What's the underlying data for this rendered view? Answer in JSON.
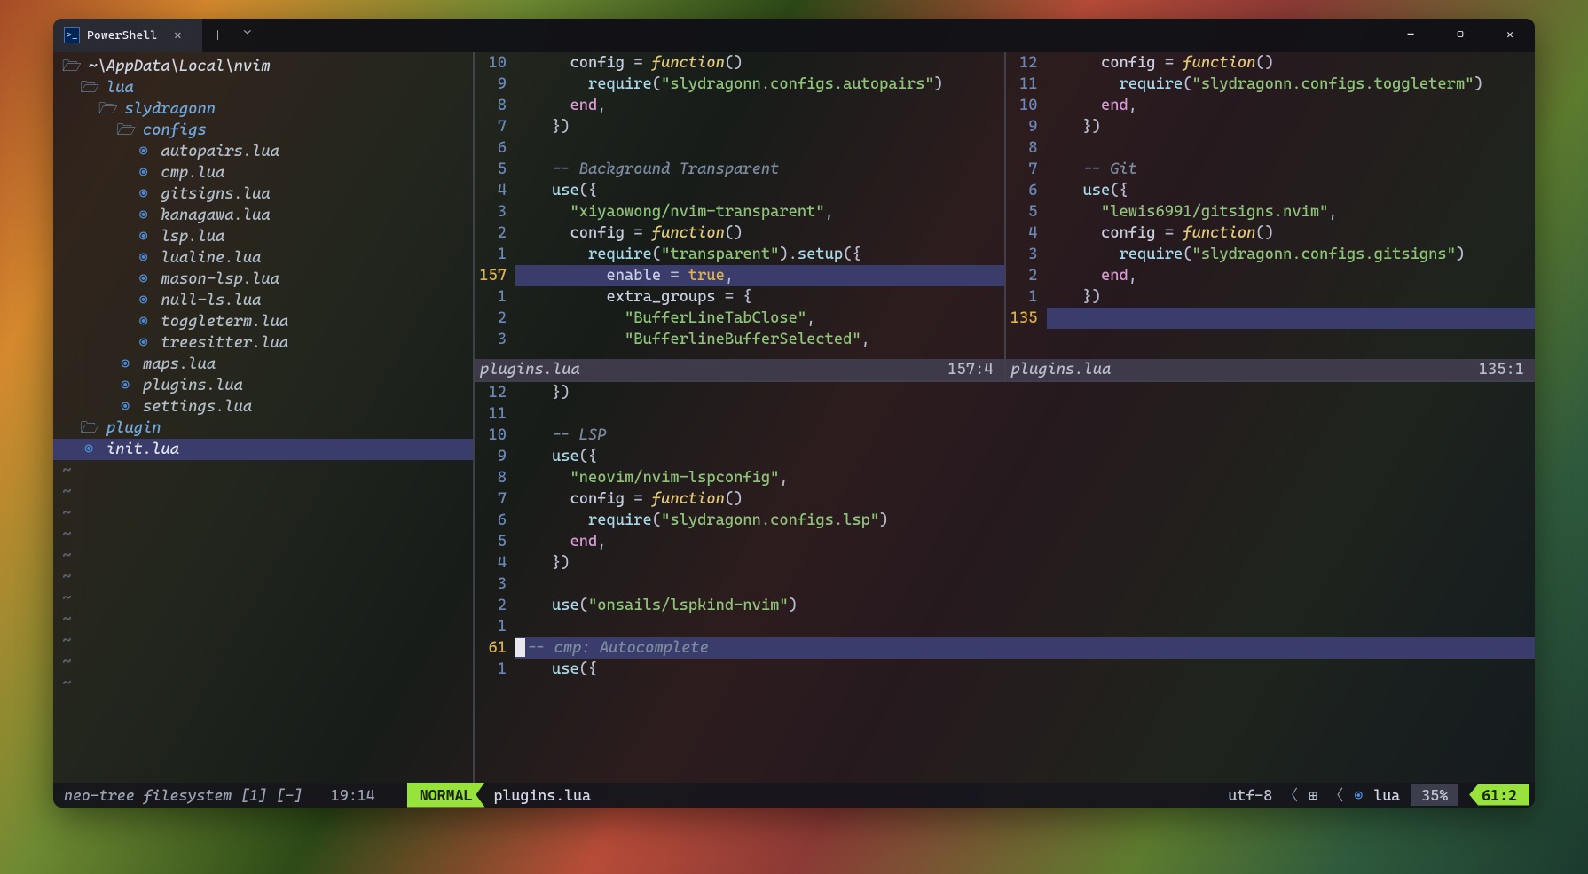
{
  "titlebar": {
    "tab_label": "PowerShell"
  },
  "tree": {
    "root": "~\\AppData\\Local\\nvim",
    "items": [
      {
        "depth": 1,
        "kind": "dir",
        "name": "lua"
      },
      {
        "depth": 2,
        "kind": "dir",
        "name": "slydragonn"
      },
      {
        "depth": 3,
        "kind": "dir",
        "name": "configs"
      },
      {
        "depth": 4,
        "kind": "file",
        "name": "autopairs.lua"
      },
      {
        "depth": 4,
        "kind": "file",
        "name": "cmp.lua"
      },
      {
        "depth": 4,
        "kind": "file",
        "name": "gitsigns.lua"
      },
      {
        "depth": 4,
        "kind": "file",
        "name": "kanagawa.lua"
      },
      {
        "depth": 4,
        "kind": "file",
        "name": "lsp.lua"
      },
      {
        "depth": 4,
        "kind": "file",
        "name": "lualine.lua"
      },
      {
        "depth": 4,
        "kind": "file",
        "name": "mason-lsp.lua"
      },
      {
        "depth": 4,
        "kind": "file",
        "name": "null-ls.lua"
      },
      {
        "depth": 4,
        "kind": "file",
        "name": "toggleterm.lua"
      },
      {
        "depth": 4,
        "kind": "file",
        "name": "treesitter.lua"
      },
      {
        "depth": 3,
        "kind": "file",
        "name": "maps.lua"
      },
      {
        "depth": 3,
        "kind": "file",
        "name": "plugins.lua"
      },
      {
        "depth": 3,
        "kind": "file",
        "name": "settings.lua"
      },
      {
        "depth": 1,
        "kind": "dir",
        "name": "plugin"
      },
      {
        "depth": 1,
        "kind": "file",
        "name": "init.lua",
        "active": true
      }
    ]
  },
  "pane_left": {
    "status_name": "plugins.lua",
    "status_pos": "157:4",
    "lines": [
      {
        "n": "10",
        "seg": [
          [
            "sp",
            "      "
          ],
          [
            "id",
            "config"
          ],
          [
            "op",
            " = "
          ],
          [
            "fn",
            "function"
          ],
          [
            "op",
            "()"
          ]
        ]
      },
      {
        "n": "9",
        "seg": [
          [
            "sp",
            "        "
          ],
          [
            "call",
            "require"
          ],
          [
            "op",
            "("
          ],
          [
            "str",
            "\"slydragonn.configs.autopairs\""
          ],
          [
            "op",
            ")"
          ]
        ]
      },
      {
        "n": "8",
        "seg": [
          [
            "sp",
            "      "
          ],
          [
            "kw",
            "end"
          ],
          [
            "op",
            ","
          ]
        ]
      },
      {
        "n": "7",
        "seg": [
          [
            "sp",
            "    "
          ],
          [
            "op",
            "})"
          ]
        ]
      },
      {
        "n": "6",
        "seg": []
      },
      {
        "n": "5",
        "seg": [
          [
            "sp",
            "    "
          ],
          [
            "com",
            "-- Background Transparent"
          ]
        ]
      },
      {
        "n": "4",
        "seg": [
          [
            "sp",
            "    "
          ],
          [
            "call",
            "use"
          ],
          [
            "op",
            "({"
          ]
        ]
      },
      {
        "n": "3",
        "seg": [
          [
            "sp",
            "      "
          ],
          [
            "str",
            "\"xiyaowong/nvim-transparent\""
          ],
          [
            "op",
            ","
          ]
        ]
      },
      {
        "n": "2",
        "seg": [
          [
            "sp",
            "      "
          ],
          [
            "id",
            "config"
          ],
          [
            "op",
            " = "
          ],
          [
            "fn",
            "function"
          ],
          [
            "op",
            "()"
          ]
        ]
      },
      {
        "n": "1",
        "seg": [
          [
            "sp",
            "        "
          ],
          [
            "call",
            "require"
          ],
          [
            "op",
            "("
          ],
          [
            "str",
            "\"transparent\""
          ],
          [
            "op",
            ")."
          ],
          [
            "call",
            "setup"
          ],
          [
            "op",
            "({"
          ]
        ]
      },
      {
        "n": "157",
        "cur": true,
        "seg": [
          [
            "sp",
            "          "
          ],
          [
            "id",
            "enable"
          ],
          [
            "op",
            " = "
          ],
          [
            "bool",
            "true"
          ],
          [
            "op",
            ","
          ]
        ]
      },
      {
        "n": "1",
        "seg": [
          [
            "sp",
            "          "
          ],
          [
            "id",
            "extra_groups"
          ],
          [
            "op",
            " = {"
          ]
        ]
      },
      {
        "n": "2",
        "seg": [
          [
            "sp",
            "            "
          ],
          [
            "str",
            "\"BufferLineTabClose\""
          ],
          [
            "op",
            ","
          ]
        ]
      },
      {
        "n": "3",
        "seg": [
          [
            "sp",
            "            "
          ],
          [
            "str",
            "\"BufferlineBufferSelected\""
          ],
          [
            "op",
            ","
          ]
        ]
      }
    ]
  },
  "pane_right": {
    "status_name": "plugins.lua",
    "status_pos": "135:1",
    "lines": [
      {
        "n": "12",
        "seg": [
          [
            "sp",
            "      "
          ],
          [
            "id",
            "config"
          ],
          [
            "op",
            " = "
          ],
          [
            "fn",
            "function"
          ],
          [
            "op",
            "()"
          ]
        ]
      },
      {
        "n": "11",
        "seg": [
          [
            "sp",
            "        "
          ],
          [
            "call",
            "require"
          ],
          [
            "op",
            "("
          ],
          [
            "str",
            "\"slydragonn.configs.toggleterm\""
          ],
          [
            "op",
            ")"
          ]
        ]
      },
      {
        "n": "10",
        "seg": [
          [
            "sp",
            "      "
          ],
          [
            "kw",
            "end"
          ],
          [
            "op",
            ","
          ]
        ]
      },
      {
        "n": "9",
        "seg": [
          [
            "sp",
            "    "
          ],
          [
            "op",
            "})"
          ]
        ]
      },
      {
        "n": "8",
        "seg": []
      },
      {
        "n": "7",
        "seg": [
          [
            "sp",
            "    "
          ],
          [
            "com",
            "-- Git"
          ]
        ]
      },
      {
        "n": "6",
        "seg": [
          [
            "sp",
            "    "
          ],
          [
            "call",
            "use"
          ],
          [
            "op",
            "({"
          ]
        ]
      },
      {
        "n": "5",
        "seg": [
          [
            "sp",
            "      "
          ],
          [
            "str",
            "\"lewis6991/gitsigns.nvim\""
          ],
          [
            "op",
            ","
          ]
        ]
      },
      {
        "n": "4",
        "seg": [
          [
            "sp",
            "      "
          ],
          [
            "id",
            "config"
          ],
          [
            "op",
            " = "
          ],
          [
            "fn",
            "function"
          ],
          [
            "op",
            "()"
          ]
        ]
      },
      {
        "n": "3",
        "seg": [
          [
            "sp",
            "        "
          ],
          [
            "call",
            "require"
          ],
          [
            "op",
            "("
          ],
          [
            "str",
            "\"slydragonn.configs.gitsigns\""
          ],
          [
            "op",
            ")"
          ]
        ]
      },
      {
        "n": "2",
        "seg": [
          [
            "sp",
            "      "
          ],
          [
            "kw",
            "end"
          ],
          [
            "op",
            ","
          ]
        ]
      },
      {
        "n": "1",
        "seg": [
          [
            "sp",
            "    "
          ],
          [
            "op",
            "})"
          ]
        ]
      },
      {
        "n": "135",
        "cur": true,
        "seg": []
      }
    ]
  },
  "pane_bottom": {
    "lines": [
      {
        "n": "12",
        "seg": [
          [
            "sp",
            "    "
          ],
          [
            "op",
            "})"
          ]
        ]
      },
      {
        "n": "11",
        "seg": []
      },
      {
        "n": "10",
        "seg": [
          [
            "sp",
            "    "
          ],
          [
            "com",
            "-- LSP"
          ]
        ]
      },
      {
        "n": "9",
        "seg": [
          [
            "sp",
            "    "
          ],
          [
            "call",
            "use"
          ],
          [
            "op",
            "({"
          ]
        ]
      },
      {
        "n": "8",
        "seg": [
          [
            "sp",
            "      "
          ],
          [
            "str",
            "\"neovim/nvim-lspconfig\""
          ],
          [
            "op",
            ","
          ]
        ]
      },
      {
        "n": "7",
        "seg": [
          [
            "sp",
            "      "
          ],
          [
            "id",
            "config"
          ],
          [
            "op",
            " = "
          ],
          [
            "fn",
            "function"
          ],
          [
            "op",
            "()"
          ]
        ]
      },
      {
        "n": "6",
        "seg": [
          [
            "sp",
            "        "
          ],
          [
            "call",
            "require"
          ],
          [
            "op",
            "("
          ],
          [
            "str",
            "\"slydragonn.configs.lsp\""
          ],
          [
            "op",
            ")"
          ]
        ]
      },
      {
        "n": "5",
        "seg": [
          [
            "sp",
            "      "
          ],
          [
            "kw",
            "end"
          ],
          [
            "op",
            ","
          ]
        ]
      },
      {
        "n": "4",
        "seg": [
          [
            "sp",
            "    "
          ],
          [
            "op",
            "})"
          ]
        ]
      },
      {
        "n": "3",
        "seg": []
      },
      {
        "n": "2",
        "seg": [
          [
            "sp",
            "    "
          ],
          [
            "call",
            "use"
          ],
          [
            "op",
            "("
          ],
          [
            "str",
            "\"onsails/lspkind-nvim\""
          ],
          [
            "op",
            ")"
          ]
        ]
      },
      {
        "n": "1",
        "seg": []
      },
      {
        "n": "61",
        "cur": true,
        "cursor": true,
        "seg": [
          [
            "com",
            "-- cmp: Autocomplete"
          ]
        ]
      },
      {
        "n": "1",
        "seg": [
          [
            "sp",
            "    "
          ],
          [
            "call",
            "use"
          ],
          [
            "op",
            "({"
          ]
        ]
      }
    ]
  },
  "statusline": {
    "left": "neo-tree filesystem [1] [-]",
    "time": "19:14",
    "mode": "NORMAL",
    "file": "plugins.lua",
    "encoding": "utf-8",
    "lang": "lua",
    "percent": "35%",
    "position": "61:2"
  }
}
